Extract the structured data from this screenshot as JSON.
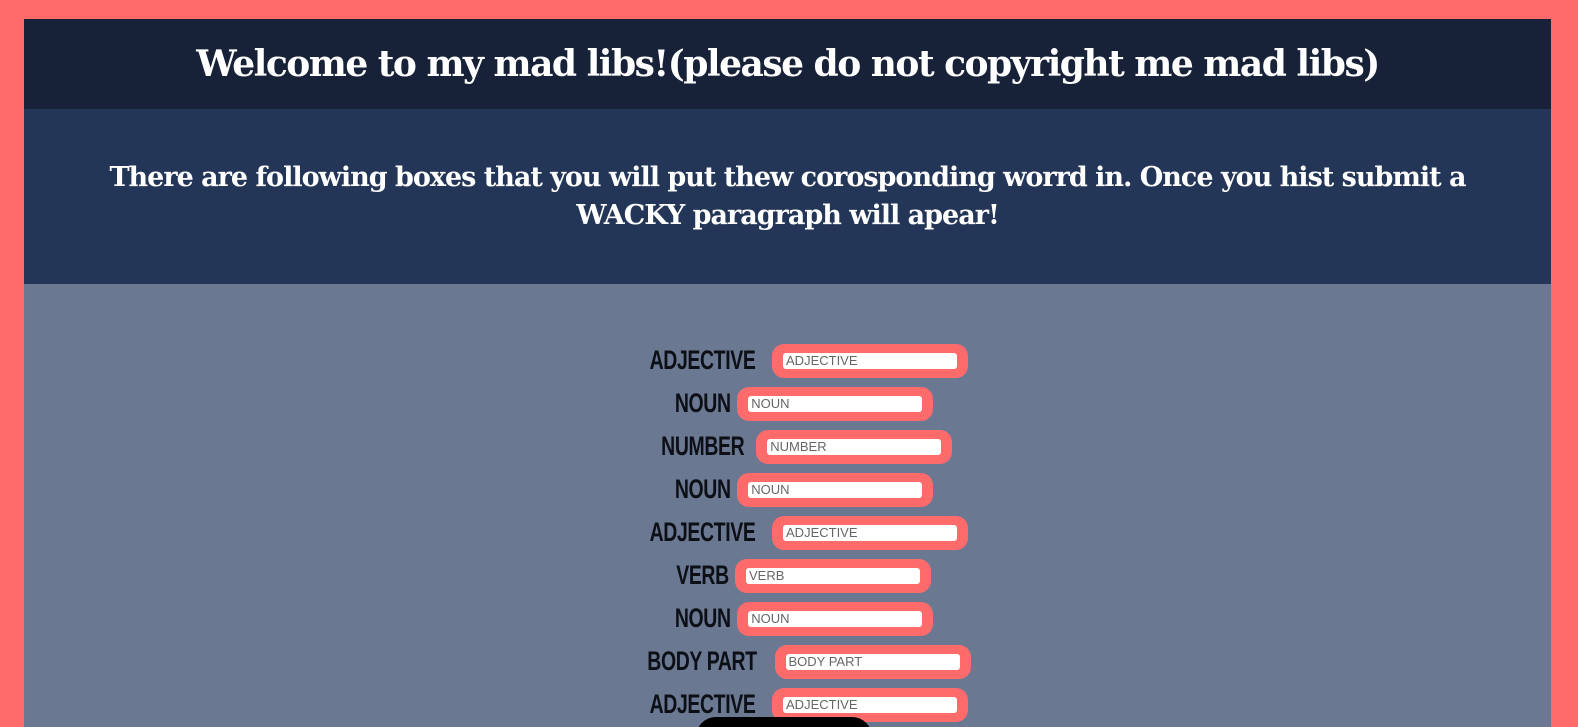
{
  "header": {
    "title": "Welcome to my mad libs!(please do not copyright me mad libs)"
  },
  "intro": {
    "text": "There are following boxes that you will put thew corosponding worrd in. Once you hist submit a WACKY paragraph will apear!"
  },
  "form": {
    "fields": [
      {
        "label": "Adjective",
        "placeholder": "ADJECTIVE",
        "value": ""
      },
      {
        "label": "Noun",
        "placeholder": "NOUN",
        "value": ""
      },
      {
        "label": "Number",
        "placeholder": "NUMBER",
        "value": ""
      },
      {
        "label": "Noun",
        "placeholder": "NOUN",
        "value": ""
      },
      {
        "label": "Adjective",
        "placeholder": "ADJECTIVE",
        "value": ""
      },
      {
        "label": "Verb",
        "placeholder": "VERB",
        "value": ""
      },
      {
        "label": "Noun",
        "placeholder": "NOUN",
        "value": ""
      },
      {
        "label": "Body Part",
        "placeholder": "BODY PART",
        "value": ""
      },
      {
        "label": "Adjective",
        "placeholder": "ADJECTIVE",
        "value": ""
      }
    ]
  },
  "colors": {
    "page_border": "#ff6b6b",
    "header_bg": "#172238",
    "intro_bg": "#243658",
    "form_bg": "#6b7891",
    "pill": "#ff6b6b"
  }
}
